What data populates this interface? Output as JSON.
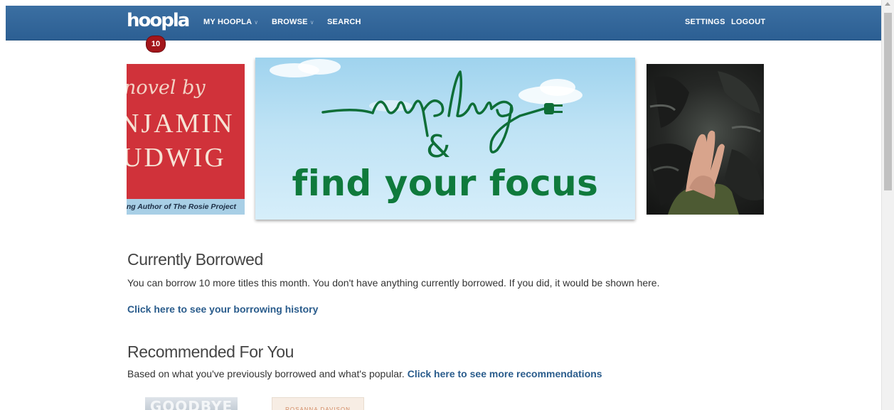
{
  "nav": {
    "logo": "hoopla",
    "badge": "10",
    "items": [
      {
        "label": "MY HOOPLA",
        "chevron": "chevron-down-icon"
      },
      {
        "label": "BROWSE",
        "chevron": "chevron-down-icon"
      },
      {
        "label": "SEARCH"
      }
    ],
    "right_items": [
      {
        "label": "SETTINGS"
      },
      {
        "label": "LOGOUT"
      }
    ],
    "bg_color": "#2e6298"
  },
  "carousel": {
    "left_slide": {
      "line1": "novel by",
      "line2": "NJAMIN",
      "line3": "UDWIG",
      "strip": "ling Author of The Rosie Project",
      "bg_color": "#d0323a"
    },
    "main_slide": {
      "script_text": "unplug",
      "ampersand": "&",
      "tagline": "find your focus",
      "text_color": "#0f7a3c"
    },
    "right_slide": {
      "description": "alien-hand-artwork"
    }
  },
  "borrowed": {
    "title": "Currently Borrowed",
    "text": "You can borrow 10 more titles this month. You don't have anything currently borrowed. If you did, it would be shown here.",
    "history_link": "Click here to see your borrowing history"
  },
  "recommended": {
    "title": "Recommended For You",
    "text": "Based on what you've previously borrowed and what's popular.",
    "more_link": "Click here to see more recommendations",
    "thumbs": [
      {
        "title": "GOODBYE"
      },
      {
        "title": "ROSANNA DAVISON"
      }
    ]
  },
  "link_color": "#2a5c8c"
}
